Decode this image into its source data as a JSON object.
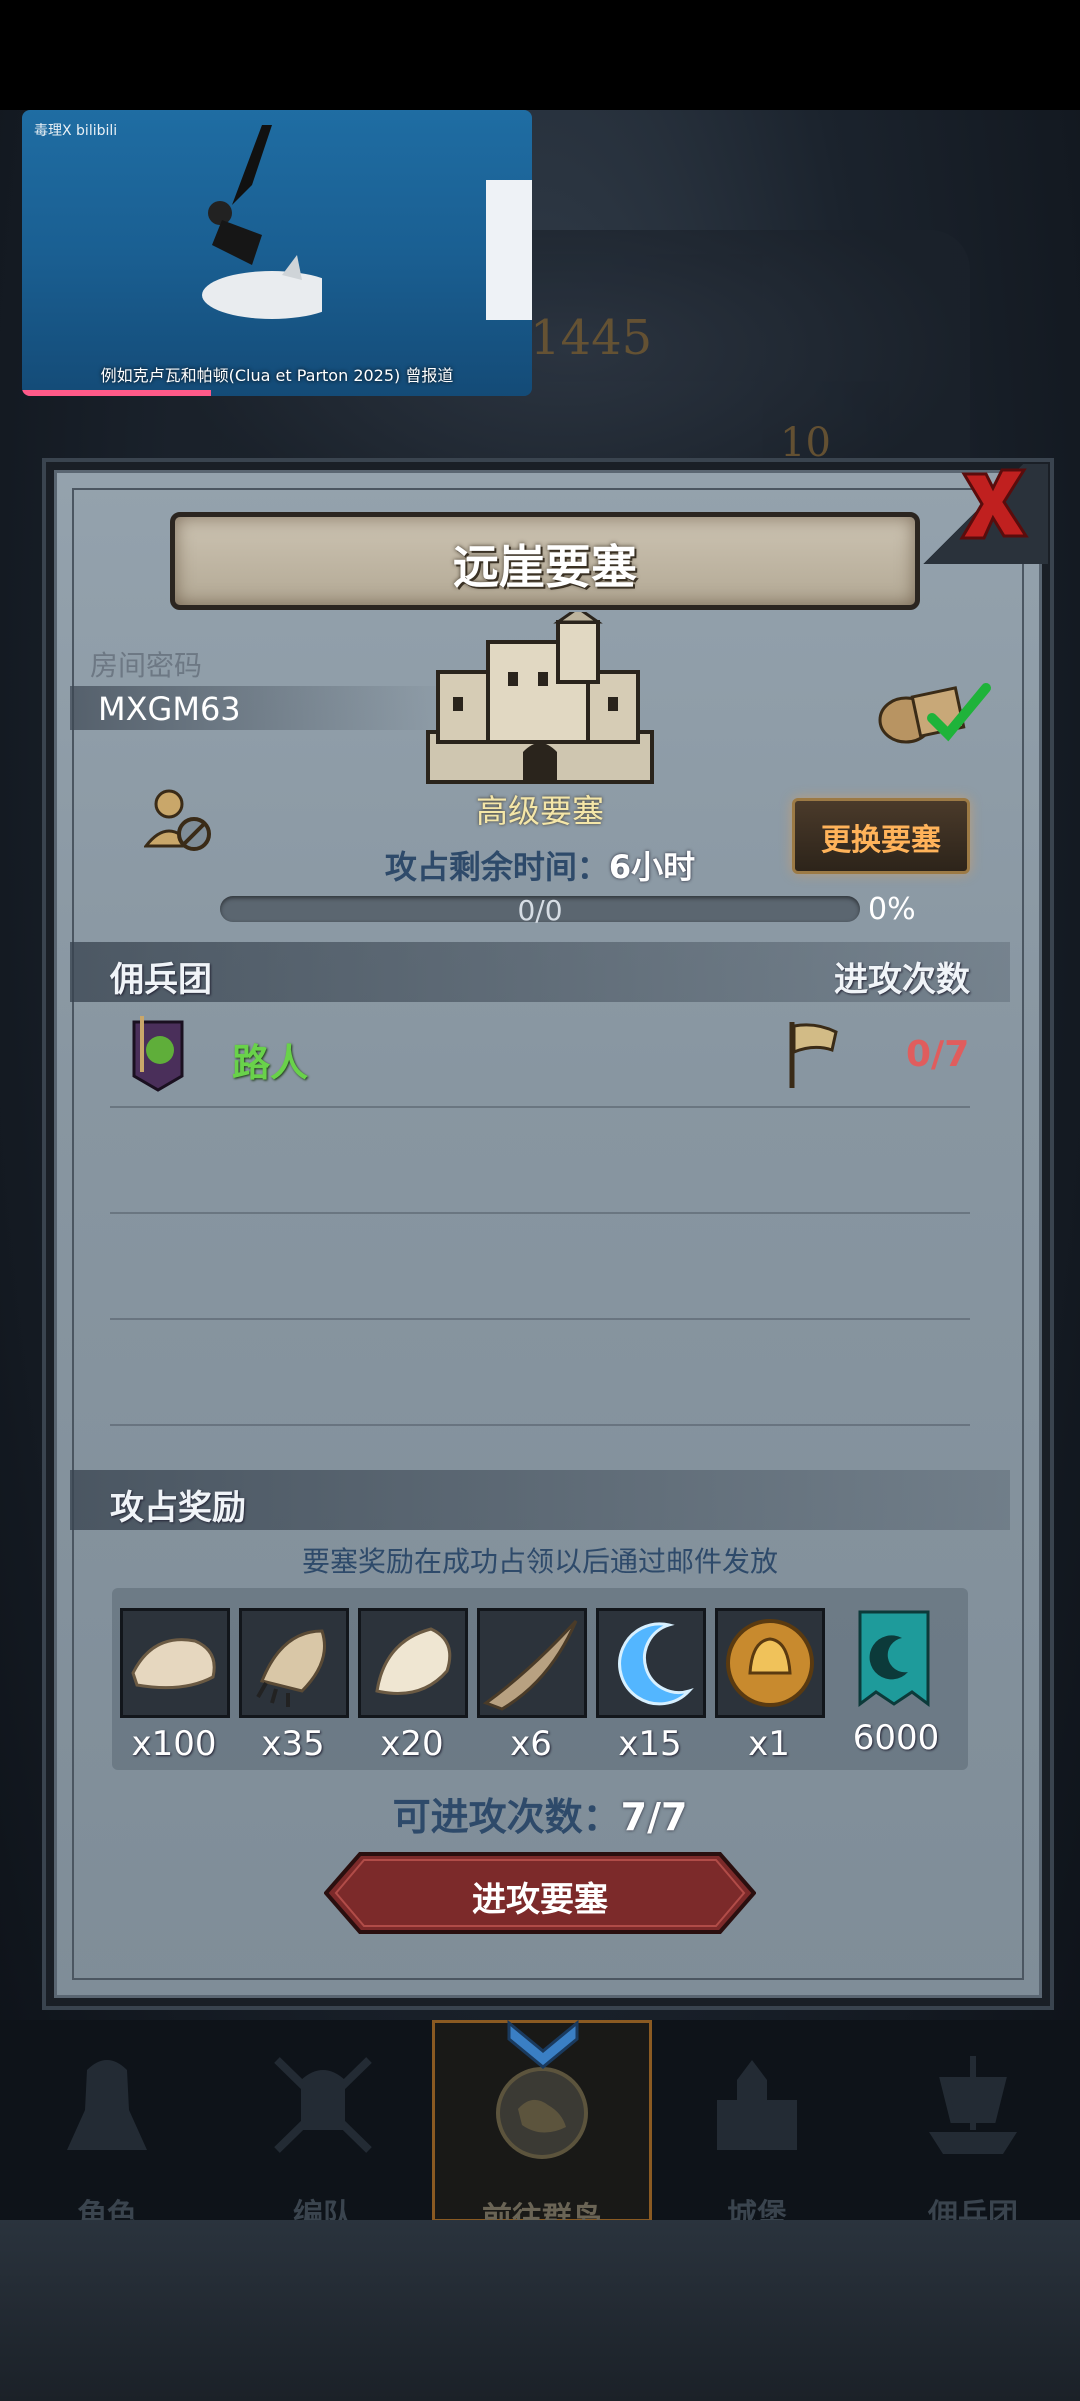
{
  "video_overlay": {
    "logo": "毒理X bilibili",
    "caption": "例如克卢瓦和帕顿(Clua et Parton 2025) 曾报道",
    "progress": 0.37
  },
  "background": {
    "clock_number_1": "1445",
    "clock_number_2": "10"
  },
  "panel": {
    "title": "远崖要塞",
    "room_code_label": "房间密码",
    "room_code": "MXGM63",
    "fortress_level": "高级要塞",
    "timer_label": "攻占剩余时间：",
    "timer_value": "6小时",
    "progress_text": "0/0",
    "progress_percent": "0%",
    "swap_button": "更换要塞",
    "guild_header": "佣兵团",
    "attacks_header": "进攻次数",
    "guild_row": {
      "name": "路人",
      "attacks": "0/7"
    },
    "rewards_header": "攻占奖励",
    "rewards_note": "要塞奖励在成功占领以后通过邮件发放",
    "rewards": [
      {
        "icon": "fur-pelt-icon",
        "qty": "x100"
      },
      {
        "icon": "claw-paw-icon",
        "qty": "x35"
      },
      {
        "icon": "feather-pelt-icon",
        "qty": "x20"
      },
      {
        "icon": "horn-icon",
        "qty": "x6"
      },
      {
        "icon": "blue-crescent-icon",
        "qty": "x15"
      },
      {
        "icon": "golden-helmet-medal-icon",
        "qty": "x1"
      },
      {
        "icon": "guild-banner-icon",
        "qty": "6000"
      }
    ],
    "available_label": "可进攻次数：",
    "available_value": "7/7",
    "attack_button": "进攻要塞"
  },
  "bottom_nav": [
    {
      "label": "角色",
      "icon": "knight-icon",
      "active": false
    },
    {
      "label": "编队",
      "icon": "helmet-swords-icon",
      "active": false
    },
    {
      "label": "前往群岛",
      "icon": "island-globe-icon",
      "active": true
    },
    {
      "label": "城堡",
      "icon": "castle-icon",
      "active": false
    },
    {
      "label": "佣兵团",
      "icon": "ship-icon",
      "active": false
    }
  ],
  "colors": {
    "accent_orange": "#ffb35a",
    "guild_green": "#69d24a",
    "attack_red": "#e05d5d",
    "panel_bg": "#8a98a3"
  }
}
